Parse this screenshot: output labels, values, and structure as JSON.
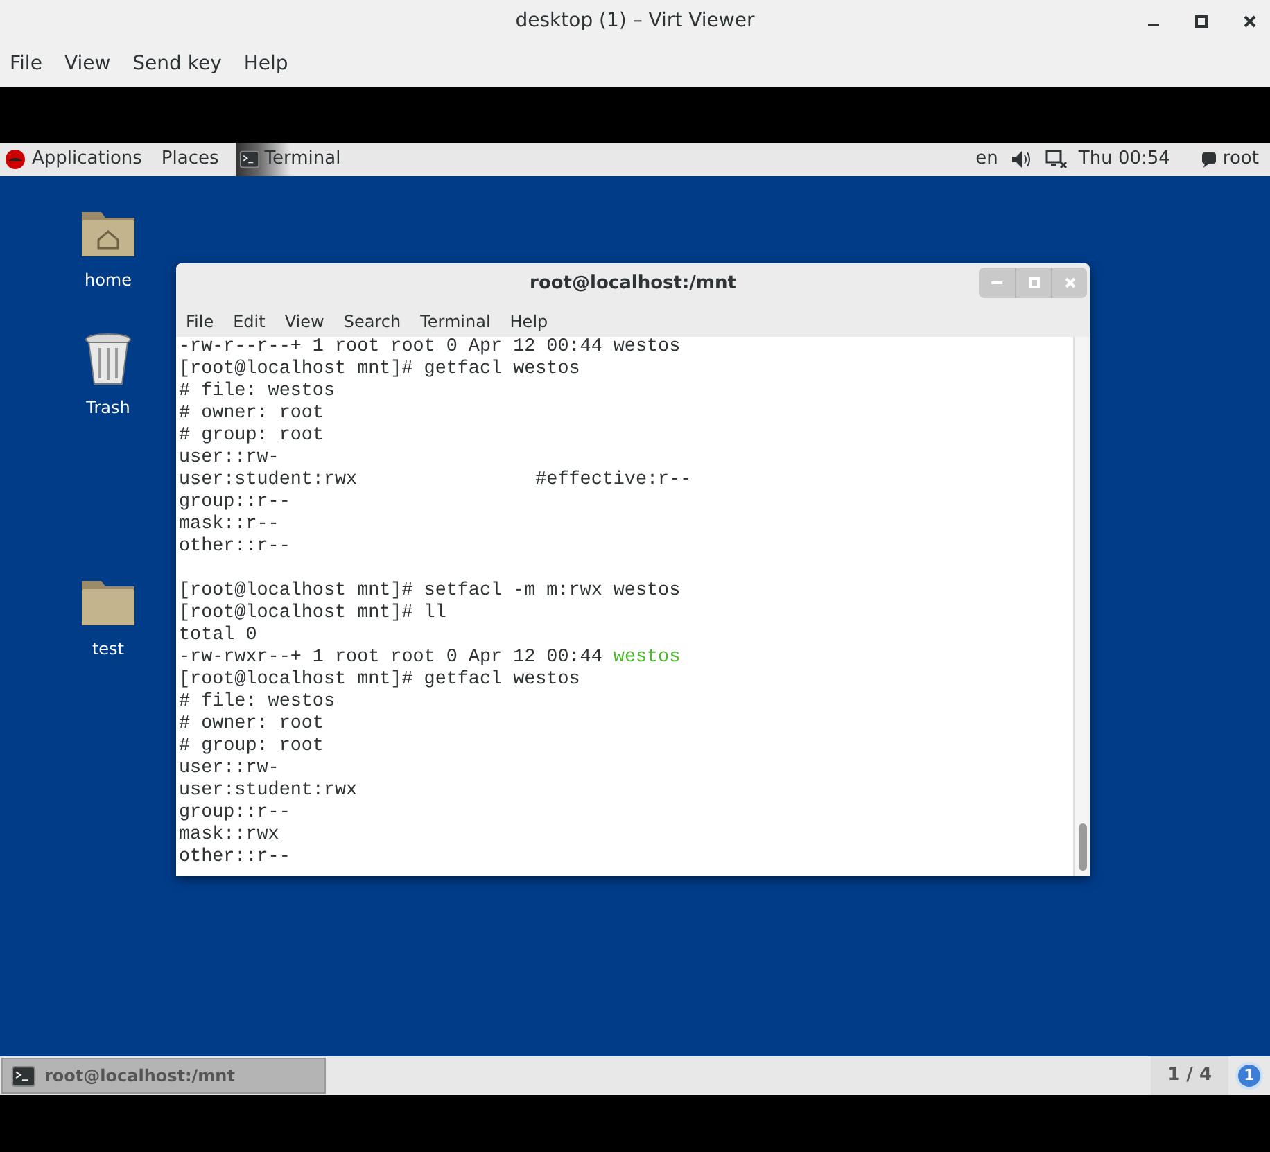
{
  "window": {
    "title": "desktop (1) – Virt Viewer"
  },
  "menu": [
    "File",
    "View",
    "Send key",
    "Help"
  ],
  "top_bar": {
    "applications": "Applications",
    "places": "Places",
    "task": "Terminal",
    "language": "en",
    "clock": "Thu 00:54",
    "user": "root"
  },
  "desktop_icons": [
    {
      "kind": "home",
      "label": "home"
    },
    {
      "kind": "trash",
      "label": "Trash"
    },
    {
      "kind": "folder",
      "label": "test"
    }
  ],
  "terminal": {
    "title": "root@localhost:/mnt",
    "menu": [
      "File",
      "Edit",
      "View",
      "Search",
      "Terminal",
      "Help"
    ],
    "lines": [
      {
        "segments": [
          {
            "text": "-rw-r--r--+ 1 root root 0 Apr 12 00:44 westos",
            "color": "#2e3436"
          }
        ]
      },
      {
        "segments": [
          {
            "text": "[root@localhost mnt]# getfacl westos",
            "color": "#2e3436"
          }
        ]
      },
      {
        "segments": [
          {
            "text": "# file: westos",
            "color": "#2e3436"
          }
        ]
      },
      {
        "segments": [
          {
            "text": "# owner: root",
            "color": "#2e3436"
          }
        ]
      },
      {
        "segments": [
          {
            "text": "# group: root",
            "color": "#2e3436"
          }
        ]
      },
      {
        "segments": [
          {
            "text": "user::rw-",
            "color": "#2e3436"
          }
        ]
      },
      {
        "segments": [
          {
            "text": "user:student:rwx                #effective:r--",
            "color": "#2e3436"
          }
        ]
      },
      {
        "segments": [
          {
            "text": "group::r--",
            "color": "#2e3436"
          }
        ]
      },
      {
        "segments": [
          {
            "text": "mask::r--",
            "color": "#2e3436"
          }
        ]
      },
      {
        "segments": [
          {
            "text": "other::r--",
            "color": "#2e3436"
          }
        ]
      },
      {
        "kind": "blank"
      },
      {
        "segments": [
          {
            "text": "[root@localhost mnt]# setfacl -m m:rwx westos",
            "color": "#2e3436"
          }
        ]
      },
      {
        "segments": [
          {
            "text": "[root@localhost mnt]# ll",
            "color": "#2e3436"
          }
        ]
      },
      {
        "segments": [
          {
            "text": "total 0",
            "color": "#2e3436"
          }
        ]
      },
      {
        "segments": [
          {
            "text": "-rw-rwxr--+ 1 root root 0 Apr 12 00:44 ",
            "color": "#2e3436"
          },
          {
            "text": "westos",
            "color": "#4cb82e"
          }
        ]
      },
      {
        "segments": [
          {
            "text": "[root@localhost mnt]# getfacl westos",
            "color": "#2e3436"
          }
        ]
      },
      {
        "segments": [
          {
            "text": "# file: westos",
            "color": "#2e3436"
          }
        ]
      },
      {
        "segments": [
          {
            "text": "# owner: root",
            "color": "#2e3436"
          }
        ]
      },
      {
        "segments": [
          {
            "text": "# group: root",
            "color": "#2e3436"
          }
        ]
      },
      {
        "segments": [
          {
            "text": "user::rw-",
            "color": "#2e3436"
          }
        ]
      },
      {
        "segments": [
          {
            "text": "user:student:rwx",
            "color": "#2e3436"
          }
        ]
      },
      {
        "segments": [
          {
            "text": "group::r--",
            "color": "#2e3436"
          }
        ]
      },
      {
        "segments": [
          {
            "text": "mask::rwx",
            "color": "#2e3436"
          }
        ]
      },
      {
        "segments": [
          {
            "text": "other::r--",
            "color": "#2e3436"
          }
        ]
      }
    ]
  },
  "bottom_panel": {
    "task": "root@localhost:/mnt",
    "workspace": "1 / 4",
    "notifications": "1"
  }
}
